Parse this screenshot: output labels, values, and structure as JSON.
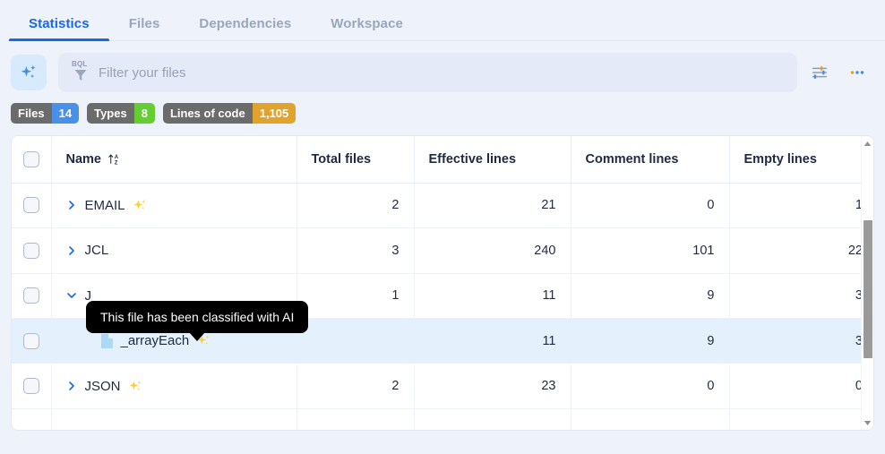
{
  "tabs": [
    {
      "label": "Statistics",
      "active": true
    },
    {
      "label": "Files",
      "active": false
    },
    {
      "label": "Dependencies",
      "active": false
    },
    {
      "label": "Workspace",
      "active": false
    }
  ],
  "toolbar": {
    "ai_button_icon": "sparkle-icon",
    "filter_prefix": "BQL",
    "filter_placeholder": "Filter your files",
    "filter_value": "",
    "settings_icon": "sliders-icon",
    "more_icon": "more-options-icon"
  },
  "badges": [
    {
      "label": "Files",
      "value": "14",
      "value_color": "#4a90e8",
      "label_color": "#6b6b6b"
    },
    {
      "label": "Types",
      "value": "8",
      "value_color": "#66cc33",
      "label_color": "#6b6b6b"
    },
    {
      "label": "Lines of code",
      "value": "1,105",
      "value_color": "#e2a32c",
      "label_color": "#6b6b6b"
    }
  ],
  "table": {
    "columns": [
      {
        "key": "check",
        "label": ""
      },
      {
        "key": "name",
        "label": "Name",
        "sort_icon": "sort-az-icon"
      },
      {
        "key": "total_files",
        "label": "Total files"
      },
      {
        "key": "effective_lines",
        "label": "Effective lines"
      },
      {
        "key": "comment_lines",
        "label": "Comment lines"
      },
      {
        "key": "empty_lines",
        "label": "Empty lines"
      }
    ],
    "rows": [
      {
        "name": "EMAIL",
        "expander": "collapsed",
        "ai": true,
        "child": false,
        "selected": false,
        "total_files": "2",
        "effective_lines": "21",
        "comment_lines": "0",
        "empty_lines": "1"
      },
      {
        "name": "JCL",
        "expander": "collapsed",
        "ai": false,
        "child": false,
        "selected": false,
        "total_files": "3",
        "effective_lines": "240",
        "comment_lines": "101",
        "empty_lines": "22"
      },
      {
        "name": "J",
        "expander": "expanded",
        "ai": false,
        "child": false,
        "selected": false,
        "total_files": "1",
        "effective_lines": "11",
        "comment_lines": "9",
        "empty_lines": "3"
      },
      {
        "name": "_arrayEach",
        "expander": "none",
        "ai": true,
        "child": true,
        "selected": true,
        "total_files": "",
        "effective_lines": "11",
        "comment_lines": "9",
        "empty_lines": "3"
      },
      {
        "name": "JSON",
        "expander": "collapsed",
        "ai": true,
        "child": false,
        "selected": false,
        "total_files": "2",
        "effective_lines": "23",
        "comment_lines": "0",
        "empty_lines": "0"
      },
      {
        "name": "",
        "expander": "none",
        "ai": false,
        "child": false,
        "selected": false,
        "total_files": "",
        "effective_lines": "",
        "comment_lines": "",
        "empty_lines": ""
      }
    ]
  },
  "tooltip": {
    "text": "This file has been classified with AI"
  },
  "colors": {
    "accent": "#1a67e8",
    "tab_inactive": "#9aa6bd",
    "page_bg": "#eef2fb",
    "row_selected": "#e4f0fc",
    "sparkle": "#ffcc33",
    "tooltip_bg": "#000000"
  }
}
